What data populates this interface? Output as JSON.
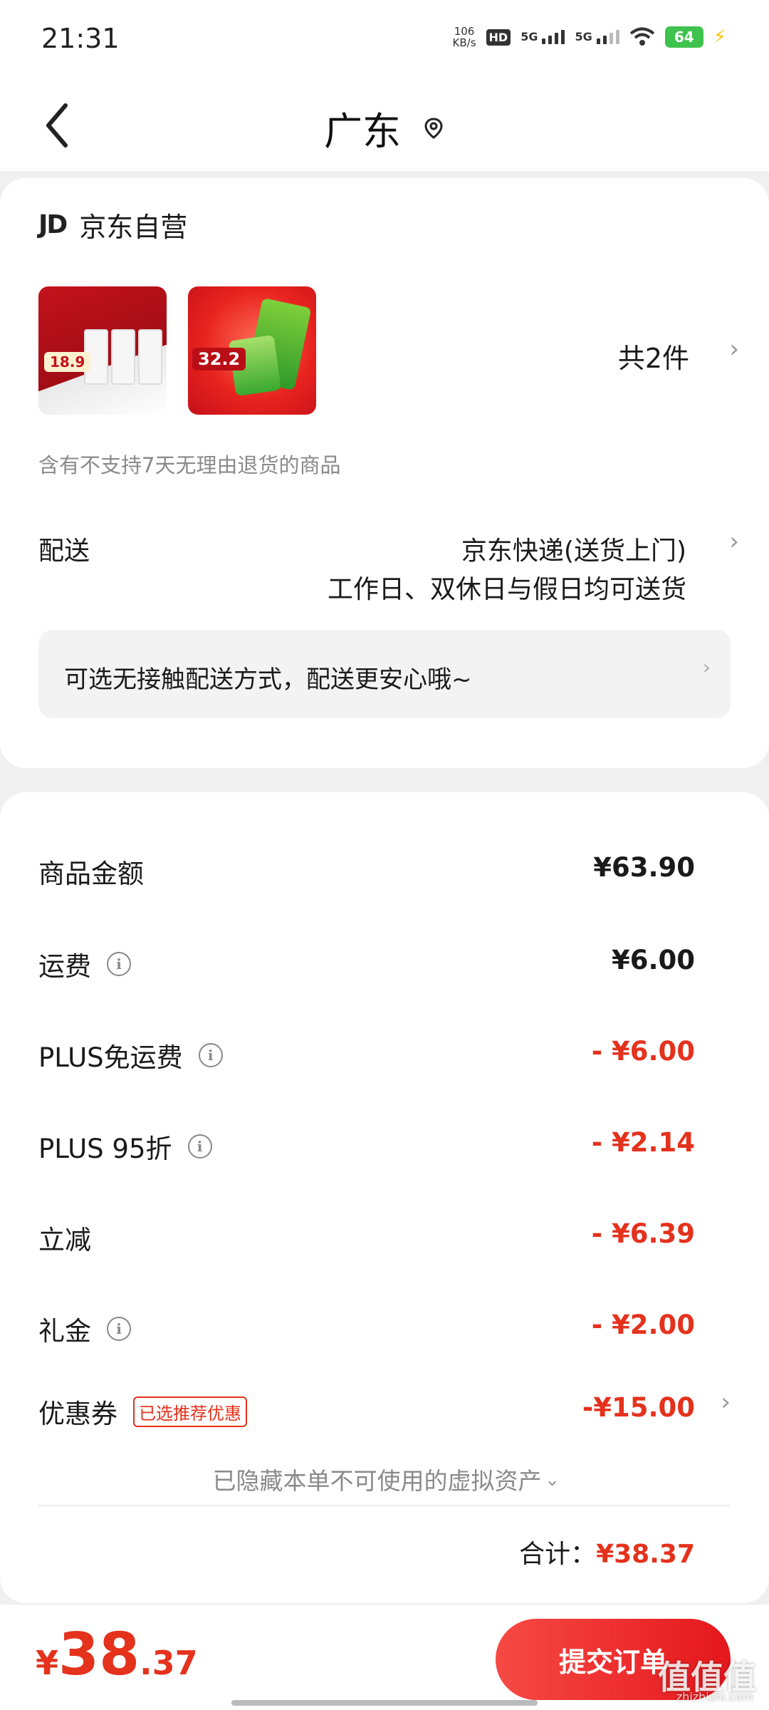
{
  "status_bar": {
    "time": "21:31",
    "net_speed_value": "106",
    "net_speed_unit": "KB/s",
    "hd_label": "HD",
    "sim1_label": "5G",
    "sim2_label": "5G",
    "battery": "64"
  },
  "header": {
    "title": "广东"
  },
  "order": {
    "seller_logo": "JD",
    "seller_name": "京东自营",
    "thumb1_badge": "18.9",
    "thumb2_badge": "32.2",
    "item_count": "共2件",
    "no_return_notice": "含有不支持7天无理由退货的商品",
    "delivery_label": "配送",
    "delivery_method": "京东快递(送货上门)",
    "delivery_days": "工作日、双休日与假日均可送货",
    "contactless_notice": "可选无接触配送方式，配送更安心哦~"
  },
  "price_rows": [
    {
      "label": "商品金额",
      "value": "¥63.90",
      "info": false,
      "red": false
    },
    {
      "label": "运费",
      "value": "¥6.00",
      "info": true,
      "red": false
    },
    {
      "label": "PLUS免运费",
      "value": "- ¥6.00",
      "info": true,
      "red": true
    },
    {
      "label": "PLUS 95折",
      "value": "- ¥2.14",
      "info": true,
      "red": true
    },
    {
      "label": "立减",
      "value": "- ¥6.39",
      "info": false,
      "red": true
    },
    {
      "label": "礼金",
      "value": "- ¥2.00",
      "info": true,
      "red": true
    }
  ],
  "coupon": {
    "label": "优惠券",
    "tag": "已选推荐优惠",
    "value": "-¥15.00"
  },
  "hidden_assets": "已隐藏本单不可使用的虚拟资产",
  "total": {
    "label": "合计：",
    "amount": "¥38.37"
  },
  "bottom": {
    "currency": "¥",
    "price_int": "38",
    "price_dec": ".37",
    "submit_label": "提交订单"
  },
  "watermark": {
    "text": "值值值",
    "sub": "zhizhizhi.com"
  },
  "colors": {
    "accent_red": "#e4321d",
    "battery_green": "#3fc24e"
  }
}
